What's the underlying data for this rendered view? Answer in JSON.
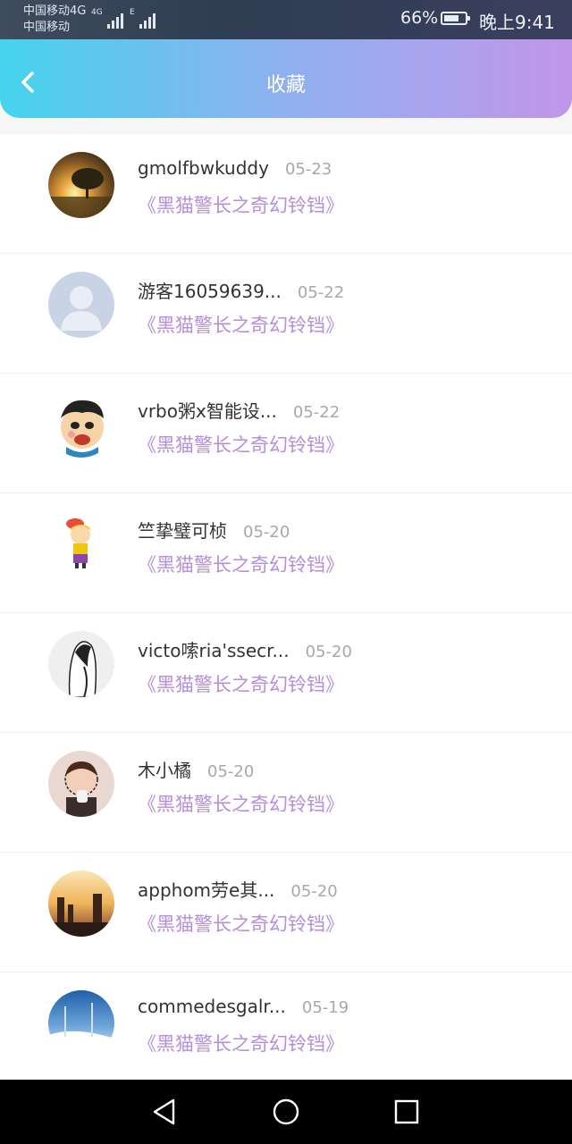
{
  "status_bar": {
    "carrier_line1": "中国移动4G",
    "carrier_line2": "中国移动",
    "network_1": "4G",
    "network_2": "E",
    "battery_percent": "66%",
    "time": "晚上9:41"
  },
  "header": {
    "title": "收藏"
  },
  "favorites": [
    {
      "user": "gmolfbwkuddy",
      "date": "05-23",
      "book": "《黑猫警长之奇幻铃铛》"
    },
    {
      "user": "游客16059639...",
      "date": "05-22",
      "book": "《黑猫警长之奇幻铃铛》"
    },
    {
      "user": "vrbo粥x智能设...",
      "date": "05-22",
      "book": "《黑猫警长之奇幻铃铛》"
    },
    {
      "user": "竺挚璧可桢",
      "date": "05-20",
      "book": "《黑猫警长之奇幻铃铛》"
    },
    {
      "user": "victo嗦ria'ssecr...",
      "date": "05-20",
      "book": "《黑猫警长之奇幻铃铛》"
    },
    {
      "user": "木小橘",
      "date": "05-20",
      "book": "《黑猫警长之奇幻铃铛》"
    },
    {
      "user": "apphom劳e其...",
      "date": "05-20",
      "book": "《黑猫警长之奇幻铃铛》"
    },
    {
      "user": "commedesgalr...",
      "date": "05-19",
      "book": "《黑猫警长之奇幻铃铛》"
    }
  ],
  "icons": {
    "back": "chevron-left-icon",
    "nav_back": "triangle-back-icon",
    "nav_home": "circle-home-icon",
    "nav_recent": "square-recent-icon"
  },
  "colors": {
    "header_gradient_start": "#45d3ee",
    "header_gradient_end": "#c196ea",
    "book_title": "#b68ed9",
    "date": "#a8a8a8"
  }
}
